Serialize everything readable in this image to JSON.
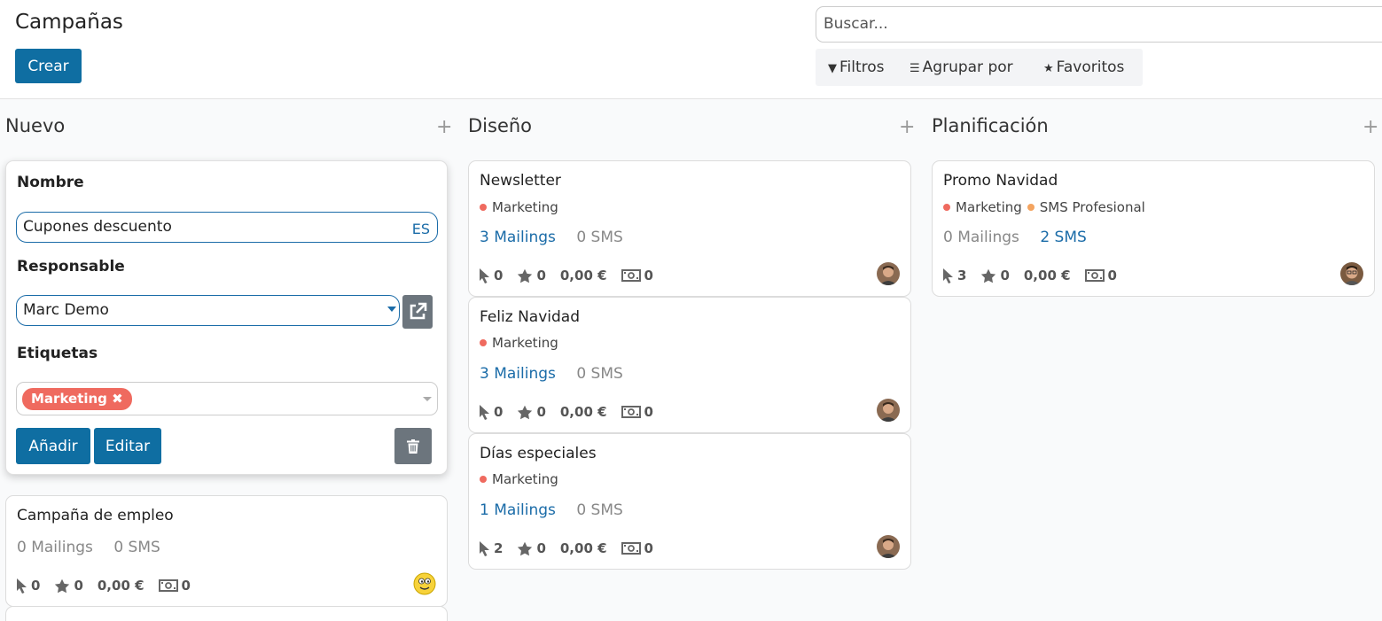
{
  "header": {
    "title": "Campañas",
    "create_label": "Crear",
    "search_placeholder": "Buscar...",
    "filters_label": "Filtros",
    "group_by_label": "Agrupar por",
    "favorites_label": "Favoritos"
  },
  "columns": [
    {
      "title": "Nuevo"
    },
    {
      "title": "Diseño"
    },
    {
      "title": "Planificación"
    }
  ],
  "quick_create": {
    "name_label": "Nombre",
    "name_value": "Cupones descuento",
    "lang": "ES",
    "responsible_label": "Responsable",
    "responsible_value": "Marc Demo",
    "tags_label": "Etiquetas",
    "tag": "Marketing",
    "tag_remove": "✖",
    "add_label": "Añadir",
    "edit_label": "Editar"
  },
  "cards": {
    "empleo": {
      "name": "Campaña de empleo",
      "mailings": "0 Mailings",
      "sms": "0 SMS",
      "clicks": "0",
      "stars": "0",
      "revenue": "0,00 €",
      "quotations": "0"
    },
    "newsletter": {
      "name": "Newsletter",
      "tags": [
        "Marketing"
      ],
      "mailings": "3 Mailings",
      "sms": "0 SMS",
      "clicks": "0",
      "stars": "0",
      "revenue": "0,00 €",
      "quotations": "0"
    },
    "feliz": {
      "name": "Feliz Navidad",
      "tags": [
        "Marketing"
      ],
      "mailings": "3 Mailings",
      "sms": "0 SMS",
      "clicks": "0",
      "stars": "0",
      "revenue": "0,00 €",
      "quotations": "0"
    },
    "dias": {
      "name": "Días especiales",
      "tags": [
        "Marketing"
      ],
      "mailings": "1 Mailings",
      "sms": "0 SMS",
      "clicks": "2",
      "stars": "0",
      "revenue": "0,00 €",
      "quotations": "0"
    },
    "promo": {
      "name": "Promo Navidad",
      "tags": [
        "Marketing",
        "SMS Profesional"
      ],
      "mailings": "0 Mailings",
      "sms": "2 SMS",
      "clicks": "3",
      "stars": "0",
      "revenue": "0,00 €",
      "quotations": "0"
    }
  },
  "colors": {
    "primary": "#0f6ea2",
    "link": "#1b6ca8",
    "tag_marketing": "#ef6a5f",
    "tag_sms": "#f4a460"
  }
}
